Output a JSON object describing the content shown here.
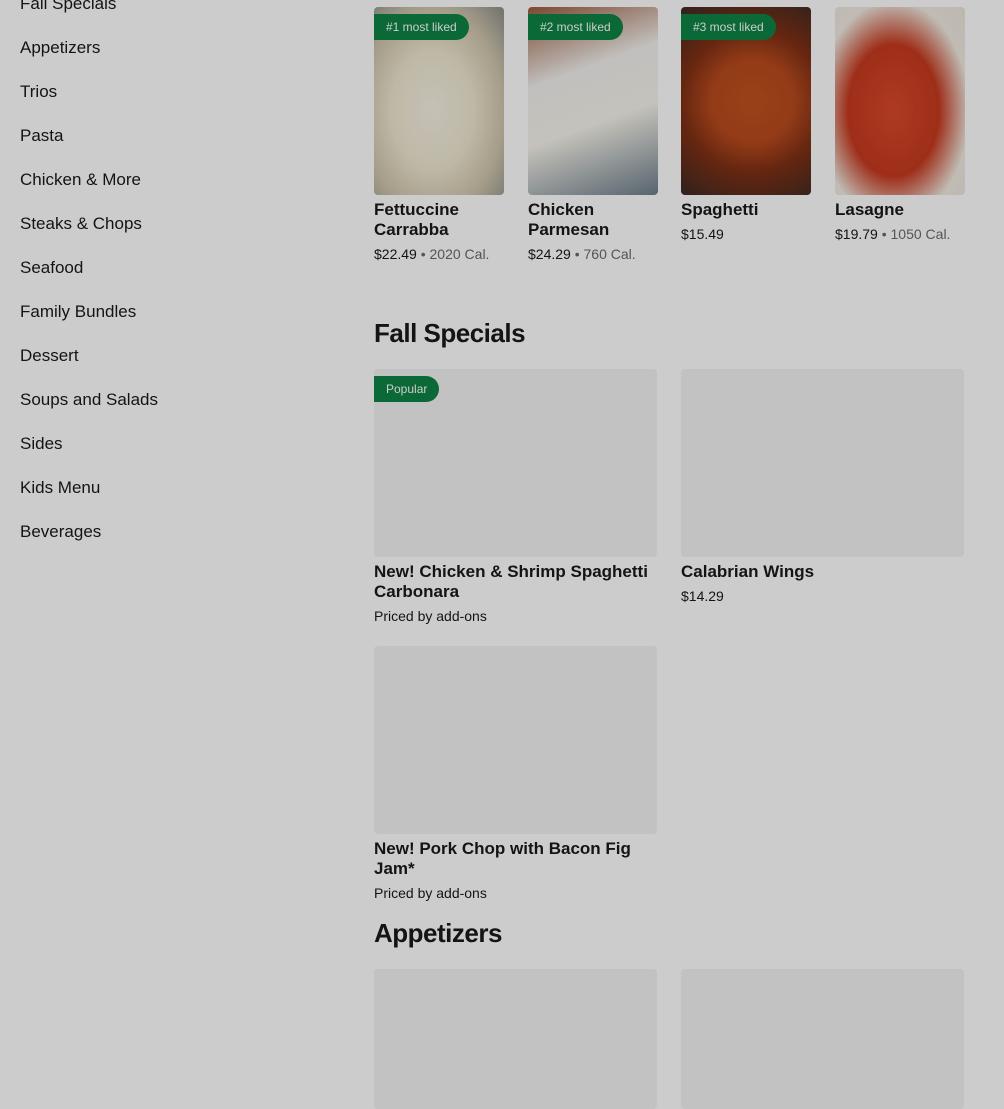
{
  "sidebar": {
    "items": [
      "Fall Specials",
      "Appetizers",
      "Trios",
      "Pasta",
      "Chicken & More",
      "Steaks & Chops",
      "Seafood",
      "Family Bundles",
      "Dessert",
      "Soups and Salads",
      "Sides",
      "Kids Menu",
      "Beverages"
    ]
  },
  "most_liked": [
    {
      "badge": "#1 most liked",
      "title": "Fettuccine Carrabba",
      "price": "$22.49",
      "separator": " • ",
      "calories": "2020 Cal."
    },
    {
      "badge": "#2 most liked",
      "title": "Chicken Parmesan",
      "price": "$24.29",
      "separator": " • ",
      "calories": "760 Cal."
    },
    {
      "badge": "#3 most liked",
      "title": "Spaghetti",
      "price": "$15.49",
      "separator": "",
      "calories": ""
    },
    {
      "badge": "",
      "title": "Lasagne",
      "price": "$19.79",
      "separator": " • ",
      "calories": "1050 Cal."
    }
  ],
  "fall_specials": {
    "title": "Fall Specials",
    "items": [
      {
        "badge": "Popular",
        "title": "New! Chicken & Shrimp Spaghetti Carbonara",
        "meta": "Priced by add-ons"
      },
      {
        "badge": "",
        "title": "Calabrian Wings",
        "meta": "$14.29"
      },
      {
        "badge": "",
        "title": "New! Pork Chop with Bacon Fig Jam*",
        "meta": "Priced by add-ons"
      }
    ]
  },
  "appetizers": {
    "title": "Appetizers"
  },
  "colors": {
    "badge_green": "#0e8345",
    "placeholder": "#f3f3f3",
    "overlay": "rgba(0,0,0,0.2)"
  }
}
